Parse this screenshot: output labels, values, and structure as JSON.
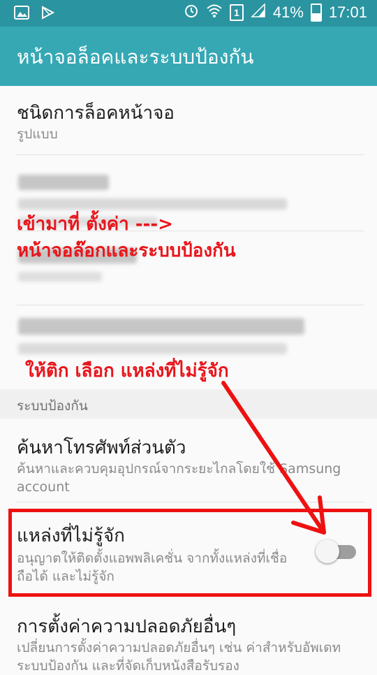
{
  "status_bar": {
    "left_icons": [
      "image-icon",
      "play-store-icon"
    ],
    "right_icons": [
      "alarm-icon",
      "wifi-icon",
      "sim-icon",
      "signal-icon",
      "battery-icon"
    ],
    "sim_number": "1",
    "battery_percent": "41%",
    "time": "17:01"
  },
  "app_bar": {
    "title": "หน้าจอล็อคและระบบป้องกัน"
  },
  "lock_screen_type": {
    "title": "ชนิดการล็อคหน้าจอ",
    "subtitle": "รูปแบบ"
  },
  "section_header": "ระบบป้องกัน",
  "find_my_mobile": {
    "title": "ค้นหาโทรศัพท์ส่วนตัว",
    "subtitle": "ค้นหาและควบคุมอุปกรณ์จากระยะไกลโดยใช้ Samsung account"
  },
  "unknown_sources": {
    "title": "แหล่งที่ไม่รู้จัก",
    "subtitle": "อนุญาตให้ติดตั้งแอพพลิเคชั่น จากทั้งแหล่งที่เชื่อถือได้ และไม่รู้จัก",
    "toggle_on": false
  },
  "other_security": {
    "title": "การตั้งค่าความปลอดภัยอื่นๆ",
    "subtitle": "เปลี่ยนการตั้งค่าความปลอดภัยอื่นๆ เช่น ค่าสำหรับอัพเดทระบบป้องกัน และที่จัดเก็บหนังสือรับรอง"
  },
  "annotations": {
    "step1_line1": "เข้ามาที่ ตั้งค่า   --->",
    "step1_line2": "หน้าจอล๊อกและระบบป้องกัน",
    "step2": "ให้ติก เลือก แหล่งที่ไม่รู้จัก"
  },
  "colors": {
    "status_bar": "#2a94a0",
    "app_bar": "#35a8b4",
    "annotation_red": "#e8151b"
  }
}
